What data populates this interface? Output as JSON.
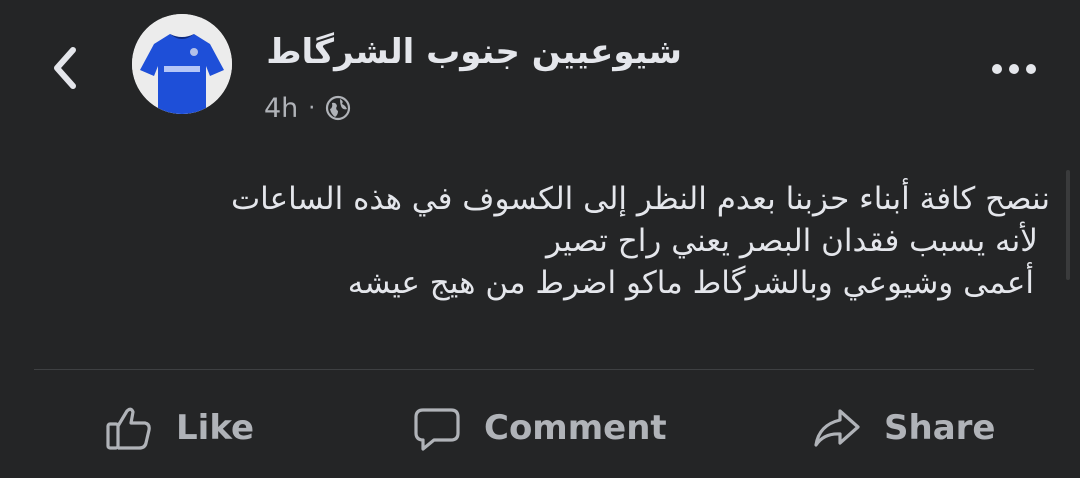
{
  "header": {
    "back_icon": "chevron-left-icon",
    "avatar_icon": "blue-football-jersey-avatar",
    "page_name": "شيوعيين جنوب الشرگاط",
    "time": "4h",
    "separator": "·",
    "audience_icon": "globe-icon",
    "more_icon": "more-horizontal-icon"
  },
  "post": {
    "lines": [
      "ننصح كافة أبناء حزبنا بعدم النظر إلى الكسوف في هذه الساعات",
      "لأنه يسبب فقدان البصر يعني راح تصير",
      "أعمى وشيوعي وبالشرگاط ماكو اضرط من هيج عيشه"
    ]
  },
  "actions": {
    "like_label": "Like",
    "comment_label": "Comment",
    "share_label": "Share",
    "like_icon": "thumbs-up-icon",
    "comment_icon": "speech-bubble-icon",
    "share_icon": "share-arrow-icon"
  },
  "colors": {
    "background": "#242526",
    "primary_text": "#e4e6eb",
    "secondary_text": "#b0b3b8",
    "divider": "#3e4042",
    "avatar_jersey": "#1e4fd8"
  }
}
